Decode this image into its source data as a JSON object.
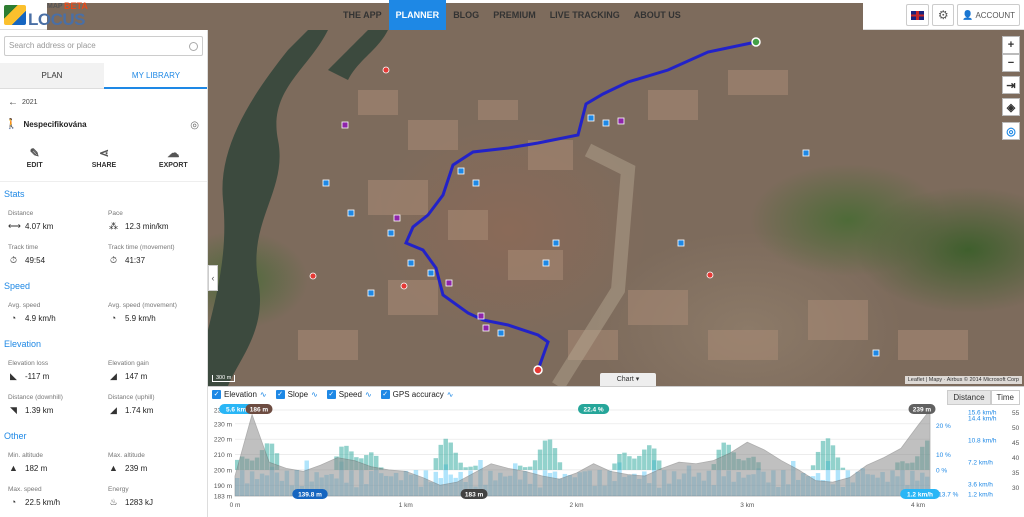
{
  "brand": {
    "map": "MAP",
    "beta": "BETA",
    "name": "LOCUS"
  },
  "nav": [
    "THE APP",
    "PLANNER",
    "BLOG",
    "PREMIUM",
    "LIVE TRACKING",
    "ABOUT US"
  ],
  "nav_active": "PLANNER",
  "account_label": "ACCOUNT",
  "search": {
    "placeholder": "Search address or place"
  },
  "tabs": [
    "PLAN",
    "MY LIBRARY"
  ],
  "back_label": "2021",
  "track_name": "Nespecifikována",
  "actions": {
    "edit": "EDIT",
    "share": "SHARE",
    "export": "EXPORT"
  },
  "sections": {
    "stats": "Stats",
    "speed": "Speed",
    "elevation": "Elevation",
    "other": "Other"
  },
  "stats": {
    "distance": {
      "label": "Distance",
      "value": "4.07 km"
    },
    "pace": {
      "label": "Pace",
      "value": "12.3 min/km"
    },
    "track_time": {
      "label": "Track time",
      "value": "49:54"
    },
    "track_time_movement": {
      "label": "Track time (movement)",
      "value": "41:37"
    },
    "avg_speed": {
      "label": "Avg. speed",
      "value": "4.9 km/h"
    },
    "avg_speed_movement": {
      "label": "Avg. speed (movement)",
      "value": "5.9 km/h"
    },
    "elevation_loss": {
      "label": "Elevation loss",
      "value": "-117 m"
    },
    "elevation_gain": {
      "label": "Elevation gain",
      "value": "147 m"
    },
    "distance_downhill": {
      "label": "Distance (downhill)",
      "value": "1.39 km"
    },
    "distance_uphill": {
      "label": "Distance (uphill)",
      "value": "1.74 km"
    },
    "min_altitude": {
      "label": "Min. altitude",
      "value": "182 m"
    },
    "max_altitude": {
      "label": "Max. altitude",
      "value": "239 m"
    },
    "max_speed": {
      "label": "Max. speed",
      "value": "22.5 km/h"
    },
    "energy": {
      "label": "Energy",
      "value": "1283 kJ"
    }
  },
  "map": {
    "chart_toggle": "Chart",
    "attribution": "Leaflet | Mapy · Airbus © 2014 Microsoft Corp",
    "scale": "300 m",
    "controls": {
      "zoom_in": "+",
      "zoom_out": "−"
    }
  },
  "chart": {
    "legend": [
      "Elevation",
      "Slope",
      "Speed",
      "GPS accuracy"
    ],
    "toggle": [
      "Distance",
      "Time"
    ],
    "toggle_active": "Distance",
    "markers": [
      "5.6 km/h",
      "186 m",
      "22.4 %",
      "239 m",
      "139.8 m",
      "183 m",
      "1.2 km/h"
    ]
  },
  "chart_data": {
    "type": "area",
    "x": [
      0,
      0.1,
      0.2,
      0.3,
      0.4,
      0.5,
      0.6,
      0.7,
      0.8,
      0.9,
      1.0,
      1.1,
      1.2,
      1.3,
      1.4,
      1.5,
      1.6,
      1.7,
      1.8,
      1.9,
      2.0,
      2.1,
      2.2,
      2.3,
      2.4,
      2.5,
      2.6,
      2.7,
      2.8,
      2.9,
      3.0,
      3.1,
      3.2,
      3.3,
      3.4,
      3.5,
      3.6,
      3.7,
      3.8,
      3.9,
      4.0,
      4.07
    ],
    "series": [
      {
        "name": "Elevation",
        "values": [
          196,
          236,
          205,
          201,
          199,
          203,
          208,
          206,
          202,
          200,
          199,
          195,
          190,
          192,
          198,
          204,
          201,
          199,
          196,
          194,
          198,
          204,
          199,
          197,
          196,
          201,
          205,
          204,
          206,
          211,
          218,
          213,
          206,
          200,
          193,
          192,
          195,
          203,
          208,
          214,
          229,
          239
        ]
      }
    ],
    "xlabel": "",
    "ylabel": "",
    "x_ticks": [
      "0 m",
      "1 km",
      "2 km",
      "3 km",
      "4 km"
    ],
    "y_left_ticks": [
      "183 m",
      "190 m",
      "200 m",
      "210 m",
      "220 m",
      "230 m",
      "239 m"
    ],
    "y_slope_ticks": [
      "-13.7 %",
      "0 %",
      "10 %",
      "20 %"
    ],
    "y_speed_ticks": [
      "1.2 km/h",
      "3.6 km/h",
      "7.2 km/h",
      "10.8 km/h",
      "14.4 km/h",
      "15.6 km/h"
    ],
    "y_right_ticks": [
      "30",
      "35",
      "40",
      "45",
      "50",
      "55"
    ],
    "ylim": [
      183,
      239
    ],
    "grid": true
  }
}
